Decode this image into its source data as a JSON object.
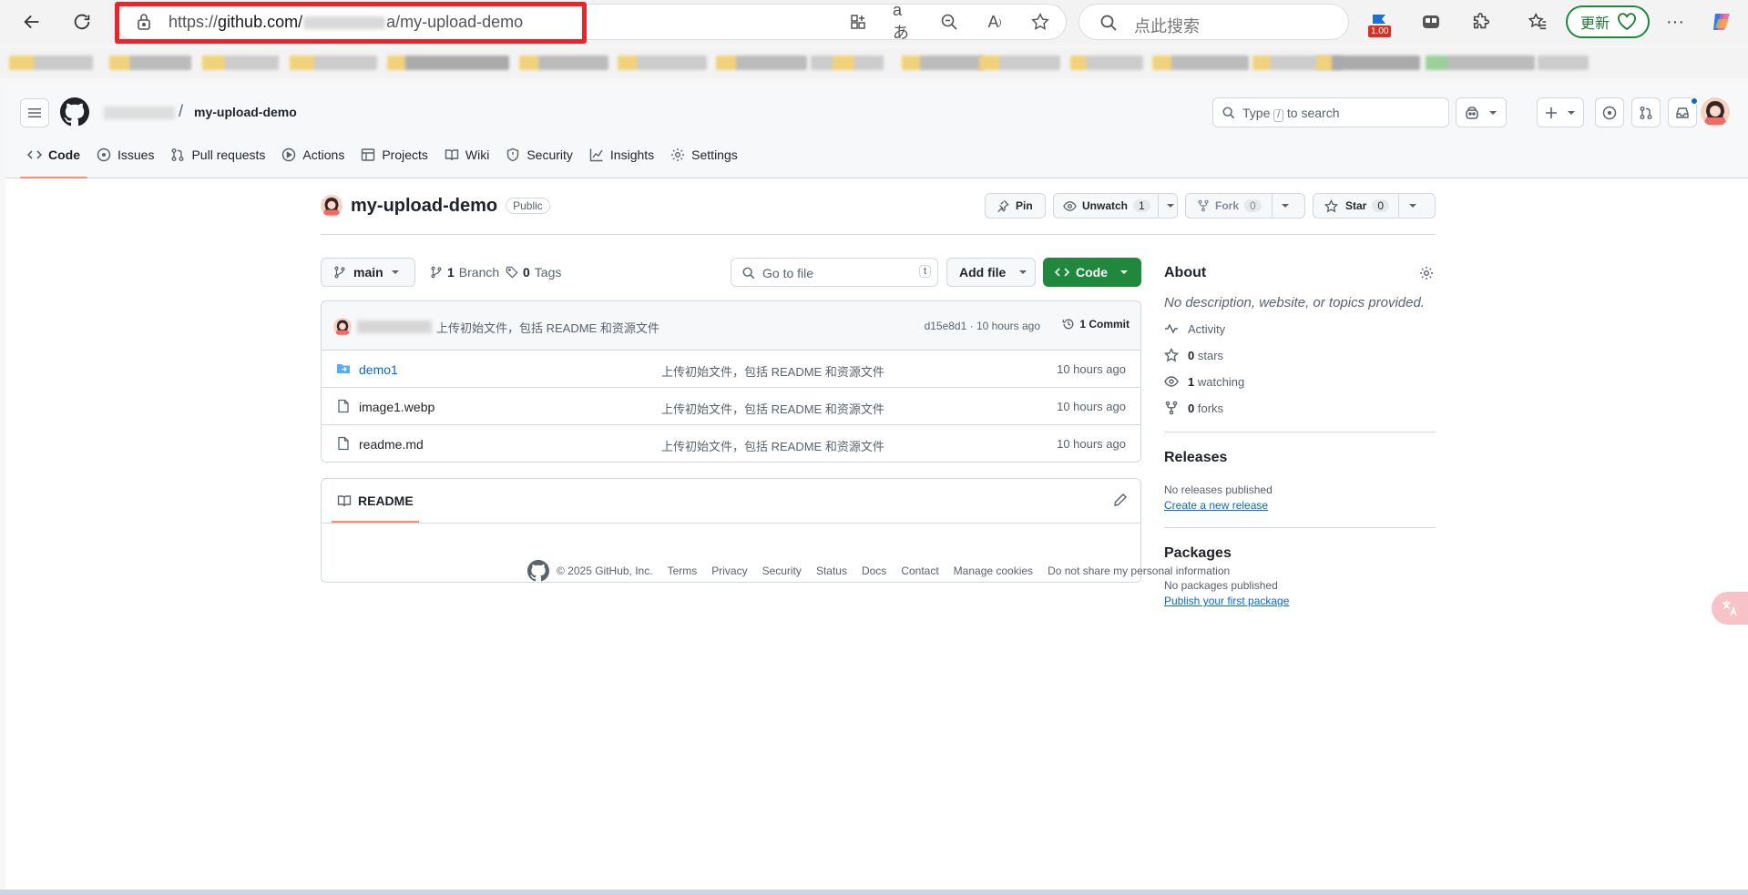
{
  "browser": {
    "url_prefix": "https://",
    "url_host": "github.com/",
    "url_path": "a/my-upload-demo",
    "search_placeholder": "点此搜索",
    "update_label": "更新",
    "ext_badge": "1.00"
  },
  "header": {
    "repo_crumb": "my-upload-demo",
    "search_pre": "Type",
    "search_key": "/",
    "search_post": "to search"
  },
  "tabs": [
    {
      "label": "Code",
      "icon": "code-icon"
    },
    {
      "label": "Issues",
      "icon": "issue-icon"
    },
    {
      "label": "Pull requests",
      "icon": "pull-request-icon"
    },
    {
      "label": "Actions",
      "icon": "play-icon"
    },
    {
      "label": "Projects",
      "icon": "table-icon"
    },
    {
      "label": "Wiki",
      "icon": "book-icon"
    },
    {
      "label": "Security",
      "icon": "shield-icon"
    },
    {
      "label": "Insights",
      "icon": "graph-icon"
    },
    {
      "label": "Settings",
      "icon": "gear-icon"
    }
  ],
  "repo": {
    "name": "my-upload-demo",
    "visibility": "Public",
    "pin": "Pin",
    "watch": "Unwatch",
    "watch_count": "1",
    "fork": "Fork",
    "fork_count": "0",
    "star": "Star",
    "star_count": "0"
  },
  "toolbar": {
    "branch": "main",
    "branches_count": "1",
    "branches_label": "Branch",
    "tags_count": "0",
    "tags_label": "Tags",
    "goto_placeholder": "Go to file",
    "goto_key": "t",
    "add_file": "Add file",
    "code": "Code"
  },
  "commit": {
    "message": "上传初始文件，包括 README 和资源文件",
    "meta": "d15e8d1 · 10 hours ago",
    "count": "1 Commit"
  },
  "files": [
    {
      "name": "demo1",
      "type": "dir",
      "message": "上传初始文件，包括 README 和资源文件",
      "time": "10 hours ago"
    },
    {
      "name": "image1.webp",
      "type": "file",
      "message": "上传初始文件，包括 README 和资源文件",
      "time": "10 hours ago"
    },
    {
      "name": "readme.md",
      "type": "file",
      "message": "上传初始文件，包括 README 和资源文件",
      "time": "10 hours ago"
    }
  ],
  "readme": {
    "tab": "README"
  },
  "about": {
    "title": "About",
    "description": "No description, website, or topics provided.",
    "activity": "Activity",
    "stars_count": "0",
    "stars_label": "stars",
    "watching_count": "1",
    "watching_label": "watching",
    "forks_count": "0",
    "forks_label": "forks"
  },
  "releases": {
    "title": "Releases",
    "empty": "No releases published",
    "link": "Create a new release"
  },
  "packages": {
    "title": "Packages",
    "empty": "No packages published",
    "link": "Publish your first package"
  },
  "footer": {
    "copyright": "© 2025 GitHub, Inc.",
    "links": [
      "Terms",
      "Privacy",
      "Security",
      "Status",
      "Docs",
      "Contact",
      "Manage cookies",
      "Do not share my personal information"
    ]
  },
  "colors": {
    "accent_green": "#1f883d",
    "tab_underline": "#fd8c73",
    "link": "#0969da",
    "highlight_red": "#e8252a"
  }
}
